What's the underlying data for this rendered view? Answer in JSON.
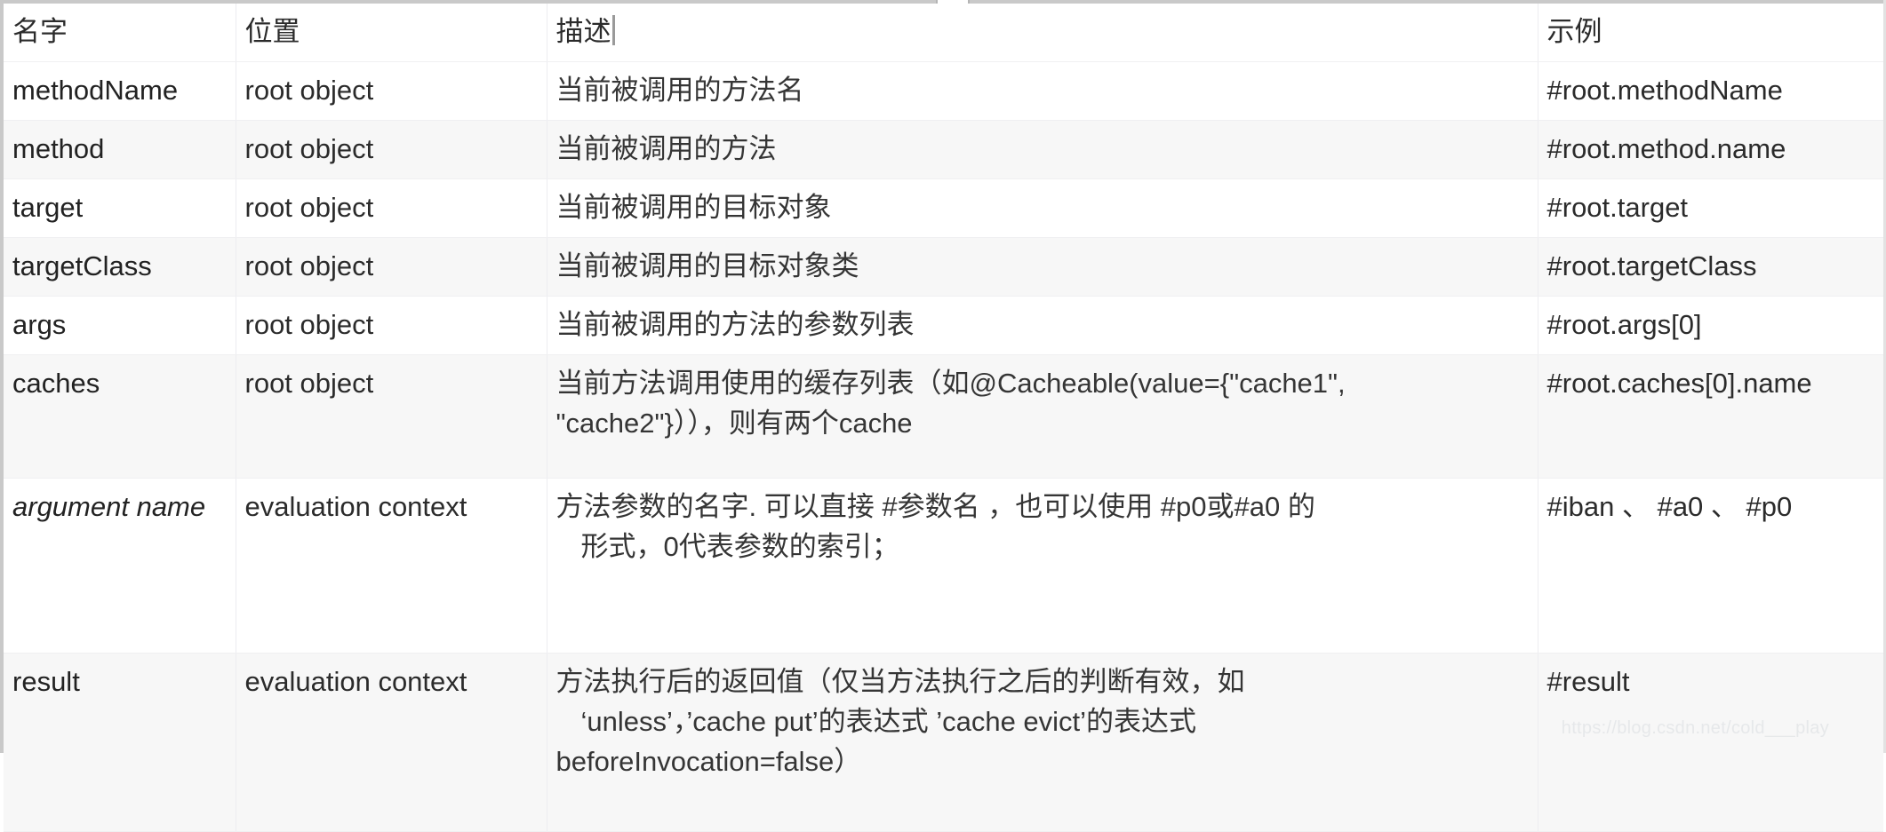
{
  "table": {
    "headers": {
      "name": "名字",
      "location": "位置",
      "description": "描述",
      "example": "示例"
    },
    "rows": [
      {
        "name": "methodName",
        "location": "root object",
        "description": "当前被调用的方法名",
        "description_line2": "",
        "description_line3": "",
        "example": "#root.methodName",
        "italic": false
      },
      {
        "name": "method",
        "location": "root object",
        "description": "当前被调用的方法",
        "description_line2": "",
        "description_line3": "",
        "example": "#root.method.name",
        "italic": false
      },
      {
        "name": "target",
        "location": "root object",
        "description": "当前被调用的目标对象",
        "description_line2": "",
        "description_line3": "",
        "example": "#root.target",
        "italic": false
      },
      {
        "name": "targetClass",
        "location": "root object",
        "description": "当前被调用的目标对象类",
        "description_line2": "",
        "description_line3": "",
        "example": "#root.targetClass",
        "italic": false
      },
      {
        "name": "args",
        "location": "root object",
        "description": "当前被调用的方法的参数列表",
        "description_line2": "",
        "description_line3": "",
        "example": "#root.args[0]",
        "italic": false
      },
      {
        "name": "caches",
        "location": "root object",
        "description": "当前方法调用使用的缓存列表（如@Cacheable(value={\"cache1\",",
        "description_line2": "\"cache2\"}）），则有两个cache",
        "description_line3": "",
        "example": "#root.caches[0].name",
        "italic": false
      },
      {
        "name": "argument name",
        "location": "evaluation context",
        "description": "方法参数的名字. 可以直接 #参数名 ，也可以使用 #p0或#a0 的",
        "description_line2": "形式，0代表参数的索引；",
        "description_line3": "",
        "example": "#iban 、 #a0 、  #p0",
        "italic": true
      },
      {
        "name": "result",
        "location": "evaluation context",
        "description": "方法执行后的返回值（仅当方法执行之后的判断有效，如",
        "description_line2": "‘unless’，’cache put’的表达式 ’cache evict’的表达式",
        "description_line3": "beforeInvocation=false）",
        "example": "#result",
        "italic": false
      }
    ]
  },
  "watermark": {
    "text": "https://blog.csdn.net/cold___play"
  }
}
